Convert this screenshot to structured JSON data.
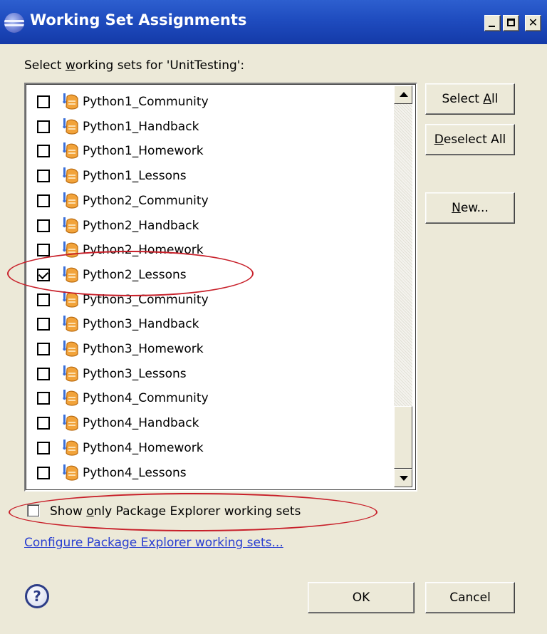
{
  "dialog": {
    "title": "Working Set Assignments",
    "prompt_prefix": "Select ",
    "prompt_mnemonic": "w",
    "prompt_suffix": "orking sets for 'UnitTesting':"
  },
  "working_sets": [
    {
      "label": "Python1_Community",
      "checked": false
    },
    {
      "label": "Python1_Handback",
      "checked": false
    },
    {
      "label": "Python1_Homework",
      "checked": false
    },
    {
      "label": "Python1_Lessons",
      "checked": false
    },
    {
      "label": "Python2_Community",
      "checked": false
    },
    {
      "label": "Python2_Handback",
      "checked": false
    },
    {
      "label": "Python2_Homework",
      "checked": false
    },
    {
      "label": "Python2_Lessons",
      "checked": true
    },
    {
      "label": "Python3_Community",
      "checked": false
    },
    {
      "label": "Python3_Handback",
      "checked": false
    },
    {
      "label": "Python3_Homework",
      "checked": false
    },
    {
      "label": "Python3_Lessons",
      "checked": false
    },
    {
      "label": "Python4_Community",
      "checked": false
    },
    {
      "label": "Python4_Handback",
      "checked": false
    },
    {
      "label": "Python4_Homework",
      "checked": false
    },
    {
      "label": "Python4_Lessons",
      "checked": false
    }
  ],
  "buttons": {
    "select_all_prefix": "Select ",
    "select_all_mnemonic": "A",
    "select_all_suffix": "ll",
    "deselect_all_mnemonic": "D",
    "deselect_all_suffix": "eselect All",
    "new_mnemonic": "N",
    "new_suffix": "ew...",
    "ok": "OK",
    "cancel": "Cancel"
  },
  "show_only": {
    "prefix": "Show ",
    "mnemonic": "o",
    "suffix": "nly Package Explorer working sets",
    "checked": false
  },
  "configure_link": "Configure Package Explorer working sets...",
  "help_glyph": "?",
  "colors": {
    "titlebar": "#1f4cbf",
    "dialog_bg": "#ece9d8",
    "link": "#2a3fd0",
    "annotation": "#c8202a"
  },
  "icons": [
    "eclipse-app-icon",
    "working-set-icon",
    "help-icon"
  ]
}
